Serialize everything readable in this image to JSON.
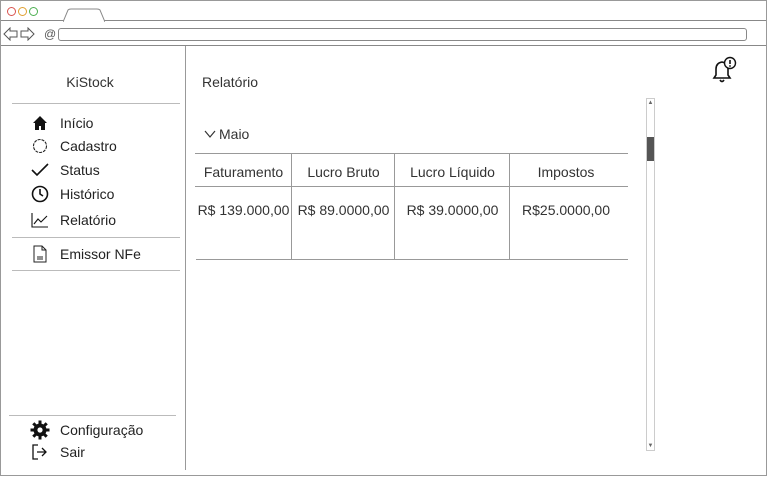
{
  "app": {
    "brand": "KiStock"
  },
  "sidebar": {
    "items": [
      {
        "label": "Início",
        "icon": "home-icon"
      },
      {
        "label": "Cadastro",
        "icon": "circle-icon"
      },
      {
        "label": "Status",
        "icon": "check-icon"
      },
      {
        "label": "Histórico",
        "icon": "clock-icon"
      },
      {
        "label": "Relatório",
        "icon": "chart-line-icon"
      },
      {
        "label": "Emissor NFe",
        "icon": "document-icon"
      }
    ],
    "footer": [
      {
        "label": "Configuração",
        "icon": "gear-icon"
      },
      {
        "label": "Sair",
        "icon": "logout-icon"
      }
    ]
  },
  "main": {
    "title": "Relatório",
    "accordion": {
      "label": "Maio",
      "expanded": true
    },
    "table": {
      "columns": [
        "Faturamento",
        "Lucro Bruto",
        "Lucro Líquido",
        "Impostos"
      ],
      "rows": [
        [
          "R$ 139.000,00",
          "R$ 89.0000,00",
          "R$ 39.0000,00",
          "R$25.0000,00"
        ]
      ]
    }
  },
  "colors": {
    "dot_red": "#d9534f",
    "dot_yellow": "#e0a030",
    "dot_green": "#4caf50",
    "border": "#999999",
    "scroll_thumb": "#555555"
  }
}
